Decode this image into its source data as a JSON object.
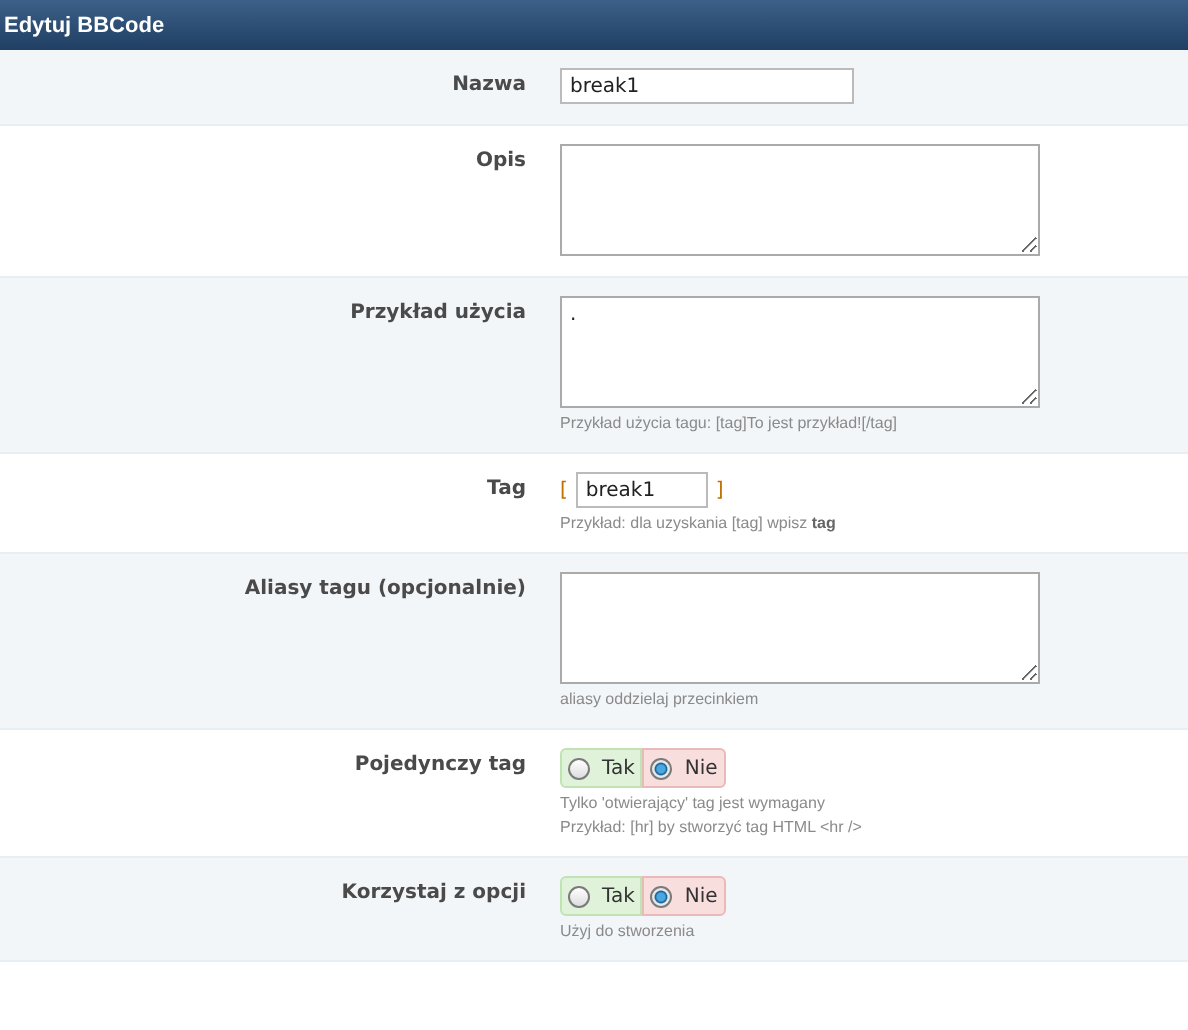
{
  "header": {
    "title": "Edytuj BBCode"
  },
  "rows": [
    {
      "label": "Nazwa",
      "kind": "text",
      "value": "break1"
    },
    {
      "label": "Opis",
      "kind": "textarea",
      "value": ""
    },
    {
      "label": "Przykład użycia",
      "kind": "textarea",
      "value": ".",
      "hints": [
        "Przykład użycia tagu: [tag]To jest przykład![/tag]"
      ]
    },
    {
      "label": "Tag",
      "kind": "tag",
      "open": "[",
      "close": "]",
      "value": "break1",
      "hints": [
        "Przykład: dla uzyskania [tag] wpisz **tag**"
      ]
    },
    {
      "label": "Aliasy tagu (opcjonalnie)",
      "kind": "textarea",
      "value": "",
      "hints": [
        "aliasy oddzielaj przecinkiem"
      ]
    },
    {
      "label": "Pojedynczy tag",
      "kind": "radio",
      "options": [
        {
          "label": "Tak",
          "selected": false
        },
        {
          "label": "Nie",
          "selected": true
        }
      ],
      "hints": [
        "Tylko 'otwierający' tag jest wymagany",
        "Przykład: [hr] by stworzyć tag HTML <hr />"
      ]
    },
    {
      "label": "Korzystaj z opcji",
      "kind": "radio",
      "options": [
        {
          "label": "Tak",
          "selected": false
        },
        {
          "label": "Nie",
          "selected": true
        }
      ],
      "hints": [
        "Użyj do stworzenia"
      ]
    }
  ]
}
